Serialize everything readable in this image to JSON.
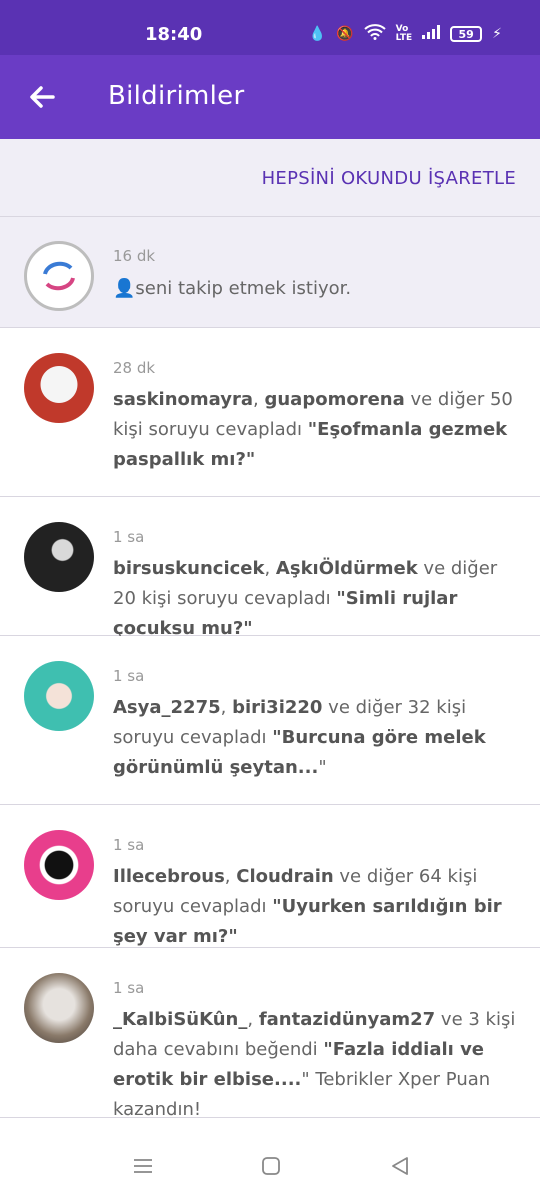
{
  "status": {
    "time": "18:40",
    "battery": "59"
  },
  "header": {
    "title": "Bildirimler"
  },
  "actions": {
    "mark_all_read": "HEPSİNİ OKUNDU İŞARETLE"
  },
  "notifications": [
    {
      "time": "16 dk",
      "text": "seni takip etmek istiyor.",
      "unread": true
    },
    {
      "time": "28 dk",
      "user1": "saskinomayra",
      "sep": ", ",
      "user2": "guapomorena",
      "middle": " ve diğer 50 kişi soruyu cevapladı ",
      "question": "\"Eşofmanla gezmek paspallık mı?\"",
      "tail": ""
    },
    {
      "time": "1 sa",
      "user1": "birsuskuncicek",
      "sep": ", ",
      "user2": "AşkıÖldürmek",
      "middle": " ve diğer 20 kişi soruyu cevapladı ",
      "question": "\"Simli rujlar çocuksu mu?\"",
      "tail": ""
    },
    {
      "time": "1 sa",
      "user1": "Asya_2275",
      "sep": ", ",
      "user2": "biri3i220",
      "middle": " ve diğer 32 kişi soruyu cevapladı ",
      "question": "\"Burcuna göre melek görünümlü şeytan...",
      "tail": "\""
    },
    {
      "time": "1 sa",
      "user1": "Illecebrous",
      "sep": ", ",
      "user2": "Cloudrain",
      "middle": " ve diğer 64 kişi soruyu cevapladı ",
      "question": "\"Uyurken sarıldığın bir şey var mı?\"",
      "tail": ""
    },
    {
      "time": "1 sa",
      "user1": "_KalbiSüKûn_",
      "sep": ", ",
      "user2": "fantazidünyam27",
      "middle": " ve 3 kişi daha cevabını beğendi ",
      "question": "\"Fazla iddialı ve erotik bir elbise....",
      "tail": "\" Tebrikler Xper Puan kazandın!"
    }
  ],
  "colors": {
    "status_bar": "#5a32b3",
    "app_bar": "#6a3cc5",
    "accent": "#5a32b3",
    "unread_bg": "#f0eef6"
  }
}
